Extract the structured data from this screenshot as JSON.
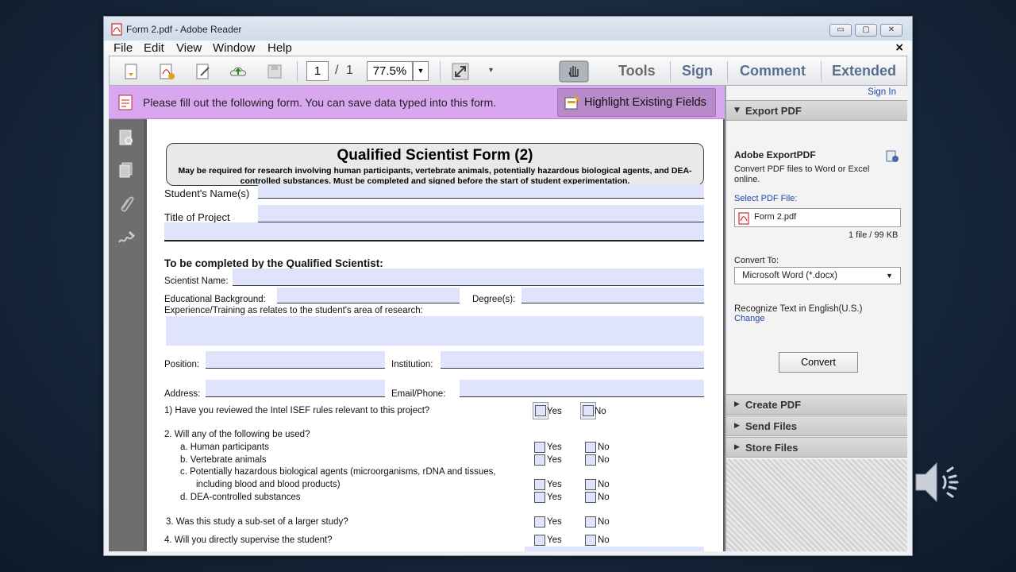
{
  "window": {
    "title": "Form 2.pdf - Adobe Reader",
    "controls": [
      "▭",
      "▢",
      "✕"
    ]
  },
  "menu": {
    "items": [
      "File",
      "Edit",
      "View",
      "Window",
      "Help"
    ],
    "close": "×"
  },
  "toolbar": {
    "page_current": "1",
    "page_separator": "/",
    "page_total": "1",
    "zoom": "77.5%",
    "links": {
      "tools": "Tools",
      "sign": "Sign",
      "comment": "Comment",
      "extended": "Extended"
    }
  },
  "notice": {
    "message": "Please fill out the following form. You can save data typed into this form.",
    "highlight_button": "Highlight Existing Fields"
  },
  "form": {
    "title": "Qualified Scientist Form (2)",
    "subtitle": "May be required for research involving human participants, vertebrate animals, potentially hazardous biological agents, and DEA-controlled substances. Must be completed and signed before the start of student experimentation.",
    "student_name_label": "Student's Name(s)",
    "project_title_label": "Title of Project",
    "section_heading": "To be completed by the Qualified Scientist:",
    "scientist_name_label": "Scientist Name:",
    "education_label": "Educational Background:",
    "degrees_label": "Degree(s):",
    "experience_label": "Experience/Training as relates to the student's area of research:",
    "position_label": "Position:",
    "institution_label": "Institution:",
    "address_label": "Address:",
    "email_label": "Email/Phone:",
    "yes": "Yes",
    "no": "No",
    "q1": "1)  Have you reviewed the Intel ISEF rules relevant to this project?",
    "q2": "2.   Will any of the following be used?",
    "q2a": "a.   Human participants",
    "q2b": "b.   Vertebrate animals",
    "q2c_1": "c.   Potentially hazardous biological agents (microorganisms, rDNA and tissues,",
    "q2c_2": "including blood and blood products)",
    "q2d": "d.   DEA-controlled substances",
    "q3": "3. Was this study a sub-set of a larger study?",
    "q4": "4.  Will you directly supervise the student?"
  },
  "right_panel": {
    "sign_in": "Sign In",
    "export_pdf": "Export PDF",
    "export_title": "Adobe ExportPDF",
    "export_desc_1": "Convert PDF files to Word or Excel",
    "export_desc_2": "online.",
    "select_label": "Select PDF File:",
    "file_name": "Form 2.pdf",
    "file_info": "1 file / 99 KB",
    "convert_to_label": "Convert To:",
    "convert_to_value": "Microsoft Word (*.docx)",
    "recognize_text": "Recognize Text in English(U.S.)",
    "change_link": "Change",
    "convert_button": "Convert",
    "create_pdf": "Create PDF",
    "send_files": "Send Files",
    "store_files": "Store Files"
  },
  "colors": {
    "notice_bg": "#d9a6f0",
    "field_fill": "#dfe3fb",
    "link_blue": "#5a6f8f"
  }
}
